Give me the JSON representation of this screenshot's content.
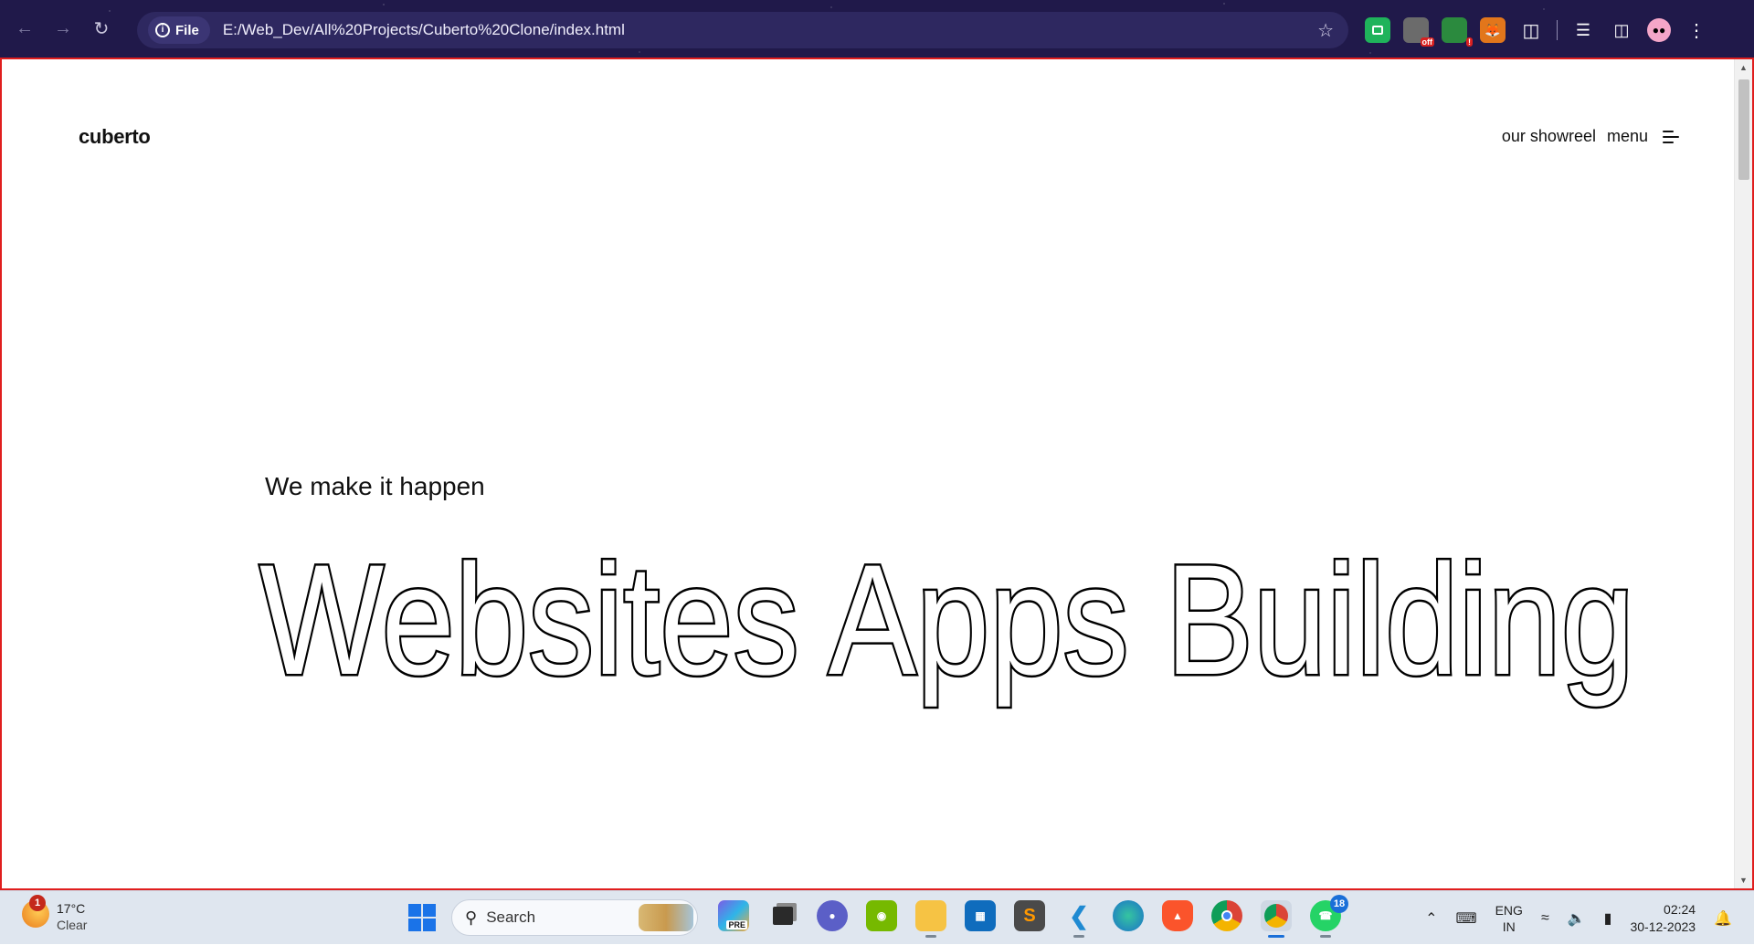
{
  "browser": {
    "site_info_label": "File",
    "url": "E:/Web_Dev/All%20Projects/Cuberto%20Clone/index.html",
    "toolbar_bg": "#20194a",
    "extensions": [
      {
        "name": "green-extension-icon",
        "color": "#1fb35b",
        "badge": ""
      },
      {
        "name": "off-extension-icon",
        "color": "#6b6b6b",
        "badge": "off"
      },
      {
        "name": "alert-extension-icon",
        "color": "#2b8a3e",
        "badge": "!"
      },
      {
        "name": "metamask-icon",
        "color": "#e2761b",
        "badge": ""
      }
    ]
  },
  "page": {
    "logo": "cuberto",
    "nav": {
      "showreel": "our showreel",
      "menu": "menu"
    },
    "subtitle": "We make it happen",
    "headline": "Websites Apps Building",
    "frame_color": "#e01e1e"
  },
  "taskbar": {
    "weather": {
      "temp": "17°C",
      "condition": "Clear",
      "badge": "1"
    },
    "search_label": "Search",
    "apps": [
      {
        "name": "copilot-icon",
        "color": "#7b5ce6",
        "label": "PRE"
      },
      {
        "name": "task-view-icon",
        "color": "#2a2a2a",
        "label": ""
      },
      {
        "name": "teams-chat-icon",
        "color": "#5b5fc7",
        "label": ""
      },
      {
        "name": "nvidia-icon",
        "color": "#76b900",
        "label": ""
      },
      {
        "name": "file-explorer-icon",
        "color": "#f6c344",
        "label": ""
      },
      {
        "name": "microsoft-store-icon",
        "color": "#0f6cbd",
        "label": ""
      },
      {
        "name": "sublime-text-icon",
        "color": "#ff9800",
        "label": "S"
      },
      {
        "name": "vscode-icon",
        "color": "#1f8ad2",
        "label": ""
      },
      {
        "name": "edge-icon",
        "color": "#1da1c9",
        "label": ""
      },
      {
        "name": "brave-icon",
        "color": "#fb542b",
        "label": ""
      },
      {
        "name": "chrome-icon",
        "color": "#db4437",
        "label": ""
      },
      {
        "name": "chrome-profile-icon",
        "color": "#4285f4",
        "label": ""
      },
      {
        "name": "whatsapp-icon",
        "color": "#25d366",
        "label": ""
      }
    ],
    "whatsapp_count": "18",
    "lang": {
      "line1": "ENG",
      "line2": "IN"
    },
    "clock": {
      "time": "02:24",
      "date": "30-12-2023"
    }
  }
}
